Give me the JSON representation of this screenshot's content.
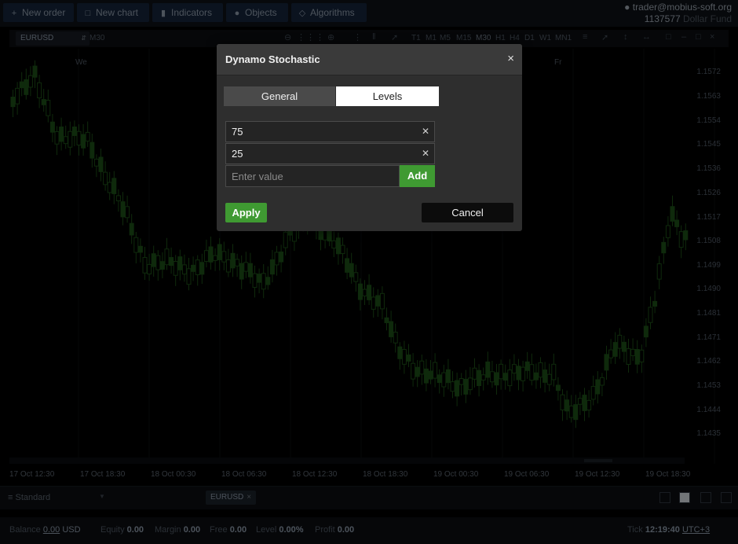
{
  "toolbar": {
    "buttons": [
      {
        "icon": "plus-icon",
        "label": "New order"
      },
      {
        "icon": "chart-icon",
        "label": "New chart"
      },
      {
        "icon": "bar-chart-icon",
        "label": "Indicators"
      },
      {
        "icon": "shapes-icon",
        "label": "Objects"
      },
      {
        "icon": "diamond-icon",
        "label": "Algorithms"
      }
    ]
  },
  "account": {
    "email": "trader@mobius-soft.org",
    "number": "1137577",
    "name": "Dollar Fund"
  },
  "chart_toolbar": {
    "symbol": "EURUSD",
    "period": "M30",
    "timeframes": [
      "T1",
      "M1",
      "M5",
      "M15",
      "M30",
      "H1",
      "H4",
      "D1",
      "W1",
      "MN1"
    ],
    "active_timeframe": "M30"
  },
  "chart": {
    "day_labels": [
      "We",
      "Fr"
    ],
    "price_labels": [
      "1.1572",
      "1.1563",
      "1.1554",
      "1.1545",
      "1.1536",
      "1.1526",
      "1.1517",
      "1.1508",
      "1.1499",
      "1.1490",
      "1.1481",
      "1.1471",
      "1.1462",
      "1.1453",
      "1.1444",
      "1.1435"
    ],
    "time_labels": [
      "17 Oct 12:30",
      "17 Oct 18:30",
      "18 Oct 00:30",
      "18 Oct 06:30",
      "18 Oct 12:30",
      "18 Oct 18:30",
      "19 Oct 00:30",
      "19 Oct 06:30",
      "19 Oct 12:30",
      "19 Oct 18:30"
    ]
  },
  "bottom": {
    "layout_name": "Standard",
    "symbol_tab": "EURUSD"
  },
  "status": {
    "balance_label": "Balance",
    "balance_value": "0.00",
    "currency": "USD",
    "equity_label": "Equity",
    "equity_value": "0.00",
    "margin_label": "Margin",
    "margin_value": "0.00",
    "free_label": "Free",
    "free_value": "0.00",
    "level_label": "Level",
    "level_value": "0.00%",
    "profit_label": "Profit",
    "profit_value": "0.00",
    "tick_label": "Tick",
    "time": "12:19:40",
    "timezone": "UTC+3"
  },
  "dialog": {
    "title": "Dynamo Stochastic",
    "close_glyph": "×",
    "tabs": [
      "General",
      "Levels"
    ],
    "active_tab": "Levels",
    "levels": [
      "75",
      "25"
    ],
    "new_level_placeholder": "Enter value",
    "add_label": "Add",
    "apply_label": "Apply",
    "cancel_label": "Cancel"
  },
  "colors": {
    "accent_green": "#3f9a32",
    "candle_green": "#1c4d17",
    "dialog_bg": "#2e2e2e"
  }
}
